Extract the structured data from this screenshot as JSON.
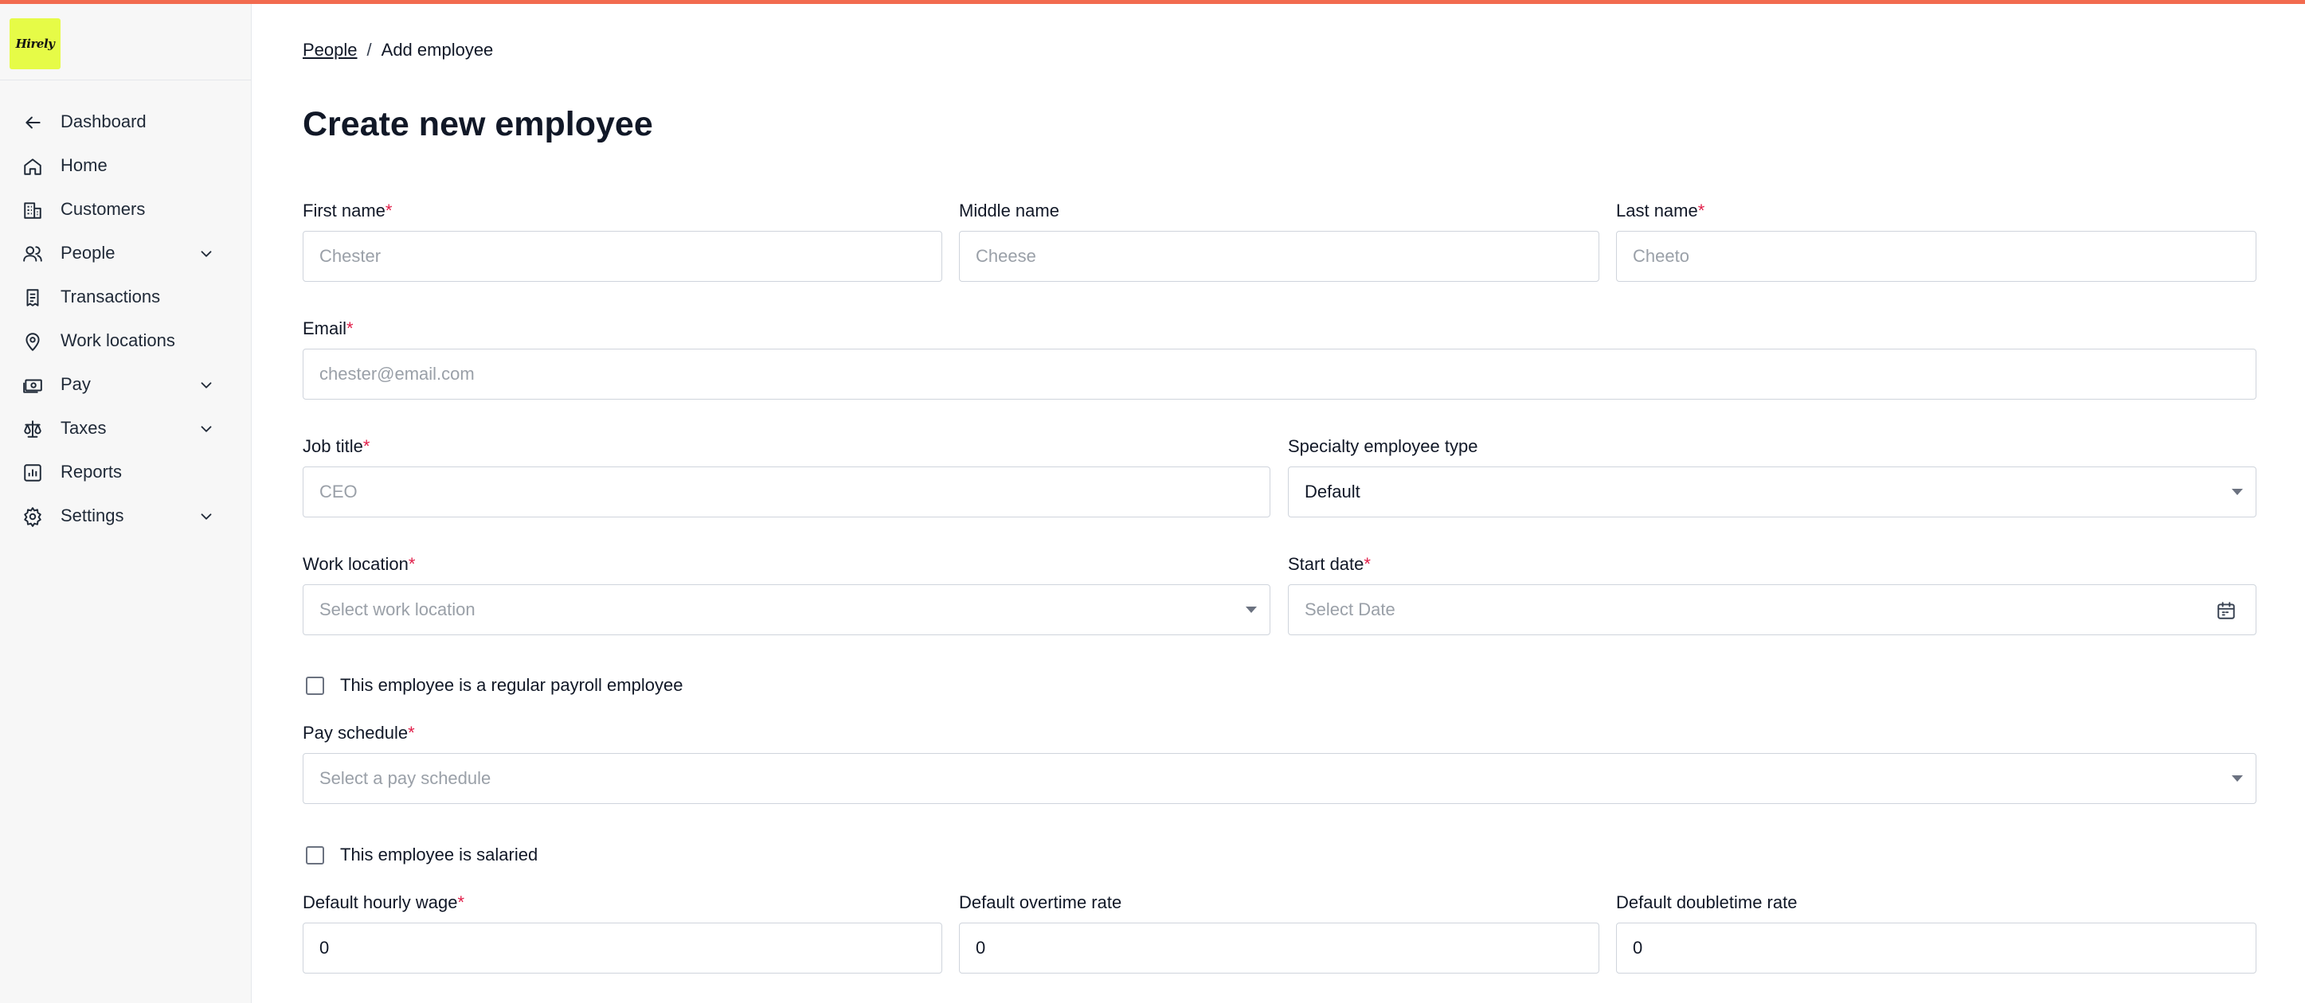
{
  "brand": {
    "logo_text": "Hirely",
    "logo_color": "#e6fb47",
    "accent": "#f26b4f"
  },
  "sidebar": {
    "items": [
      {
        "label": "Dashboard",
        "icon": "arrow-left-icon",
        "expandable": false
      },
      {
        "label": "Home",
        "icon": "home-icon",
        "expandable": false
      },
      {
        "label": "Customers",
        "icon": "building-icon",
        "expandable": false
      },
      {
        "label": "People",
        "icon": "users-icon",
        "expandable": true
      },
      {
        "label": "Transactions",
        "icon": "receipt-icon",
        "expandable": false
      },
      {
        "label": "Work locations",
        "icon": "map-pin-icon",
        "expandable": false
      },
      {
        "label": "Pay",
        "icon": "banknote-icon",
        "expandable": true
      },
      {
        "label": "Taxes",
        "icon": "scale-icon",
        "expandable": true
      },
      {
        "label": "Reports",
        "icon": "bar-chart-icon",
        "expandable": false
      },
      {
        "label": "Settings",
        "icon": "gear-icon",
        "expandable": true
      }
    ]
  },
  "breadcrumb": {
    "parent": "People",
    "separator": "/",
    "current": "Add employee"
  },
  "page": {
    "title": "Create new employee"
  },
  "form": {
    "required_mark": "*",
    "first_name": {
      "label": "First name",
      "placeholder": "Chester",
      "value": ""
    },
    "middle_name": {
      "label": "Middle name",
      "placeholder": "Cheese",
      "value": ""
    },
    "last_name": {
      "label": "Last name",
      "placeholder": "Cheeto",
      "value": ""
    },
    "email": {
      "label": "Email",
      "placeholder": "chester@email.com",
      "value": ""
    },
    "job_title": {
      "label": "Job title",
      "placeholder": "CEO",
      "value": ""
    },
    "specialty_type": {
      "label": "Specialty employee type",
      "value": "Default"
    },
    "work_location": {
      "label": "Work location",
      "placeholder": "Select work location"
    },
    "start_date": {
      "label": "Start date",
      "placeholder": "Select Date"
    },
    "regular_payroll": {
      "label": "This employee is a regular payroll employee",
      "checked": false
    },
    "pay_schedule": {
      "label": "Pay schedule",
      "placeholder": "Select a pay schedule"
    },
    "salaried": {
      "label": "This employee is salaried",
      "checked": false
    },
    "hourly_wage": {
      "label": "Default hourly wage",
      "value": "0"
    },
    "overtime_rate": {
      "label": "Default overtime rate",
      "value": "0"
    },
    "doubletime_rate": {
      "label": "Default doubletime rate",
      "value": "0"
    }
  }
}
